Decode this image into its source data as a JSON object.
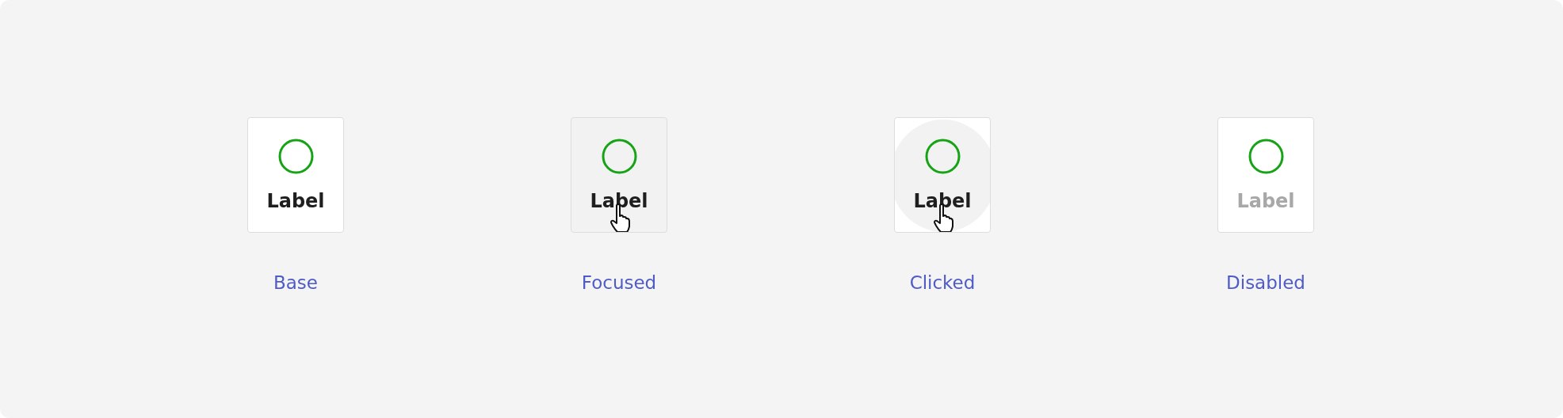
{
  "states": [
    {
      "kind": "base",
      "label": "Label",
      "caption": "Base",
      "disabled": false,
      "cursor": false
    },
    {
      "kind": "focused",
      "label": "Label",
      "caption": "Focused",
      "disabled": false,
      "cursor": true
    },
    {
      "kind": "clicked",
      "label": "Label",
      "caption": "Clicked",
      "disabled": false,
      "cursor": true
    },
    {
      "kind": "disabled",
      "label": "Label",
      "caption": "Disabled",
      "disabled": true,
      "cursor": false
    }
  ]
}
